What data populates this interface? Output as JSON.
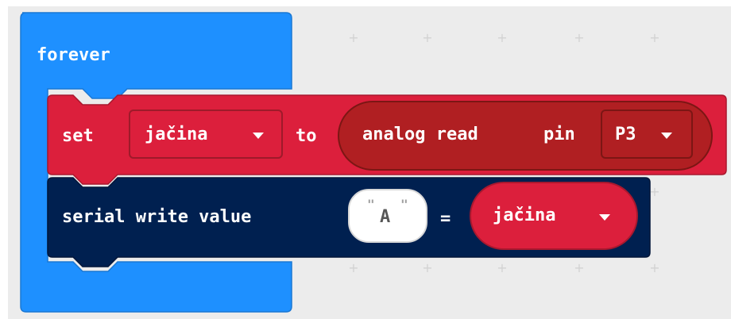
{
  "workspace": {
    "background": "#ececec"
  },
  "colors": {
    "loop": "#1e90ff",
    "variables": "#dc1f3c",
    "pins": "#b01f22",
    "serial": "#002050",
    "text": "#ffffff"
  },
  "blocks": {
    "forever": {
      "label": "forever"
    },
    "set_block": {
      "set_label": "set",
      "variable": "jačina",
      "to_label": "to",
      "analog_read": {
        "label_analog": "analog read",
        "label_pin": "pin",
        "pin_value": "P3"
      }
    },
    "serial_block": {
      "label": "serial write value",
      "string_value": "A",
      "equals_label": "=",
      "variable": "jačina"
    }
  },
  "icons": {
    "dropdown": "chevron-down-icon"
  }
}
